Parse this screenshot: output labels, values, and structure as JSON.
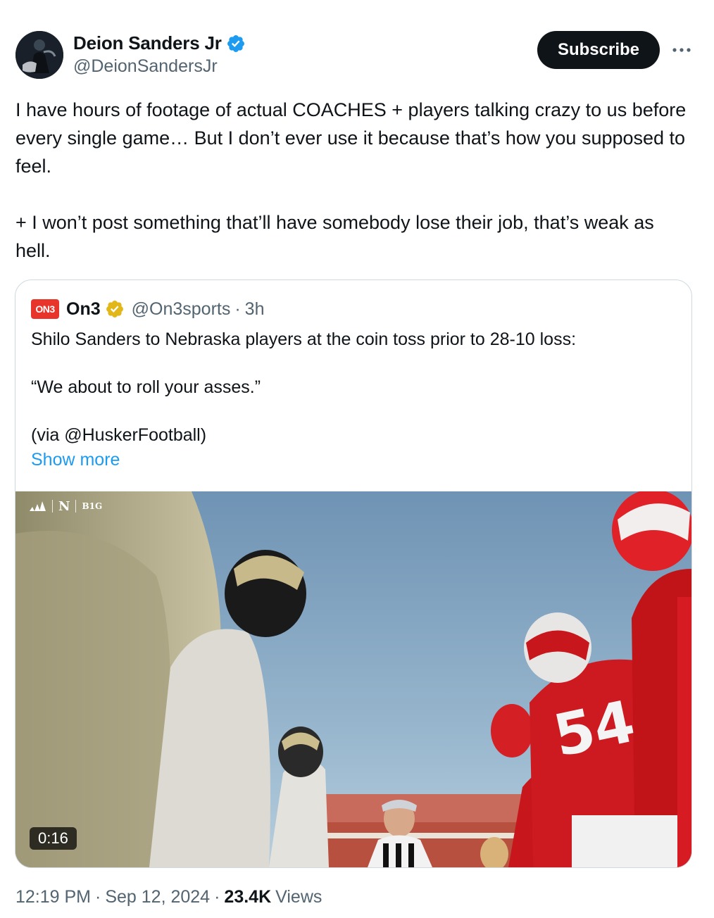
{
  "author": {
    "name": "Deion Sanders Jr",
    "handle": "@DeionSandersJr",
    "verified": true,
    "verified_color": "#1d9bf0",
    "avatar_icon": "profile-photo"
  },
  "actions": {
    "subscribe_label": "Subscribe",
    "more_icon": "ellipsis-icon"
  },
  "tweet": {
    "paragraphs": [
      "I have hours of footage of actual COACHES + players talking crazy to us before every single game… But I don’t ever use it because that’s how you supposed to feel.",
      "+ I won’t post something that’ll have somebody lose their job, that’s weak as hell."
    ]
  },
  "quote": {
    "logo_text": "ON3",
    "logo_color": "#e8352b",
    "name": "On3",
    "verified_color": "#e2b719",
    "handle": "@On3sports",
    "separator": "·",
    "time": "3h",
    "paragraphs": [
      "Shilo Sanders to Nebraska players at the coin toss prior to 28-10 loss:",
      "“We about to roll your asses.”",
      "(via @HuskerFootball)"
    ],
    "show_more": "Show more",
    "media": {
      "broadcast_marks": [
        "N",
        "B1G"
      ],
      "duration": "0:16"
    }
  },
  "meta": {
    "time": "12:19 PM",
    "sep1": "·",
    "date": "Sep 12, 2024",
    "sep2": "·",
    "views_count": "23.4K",
    "views_label": "Views"
  },
  "colors": {
    "text_primary": "#0f1419",
    "text_secondary": "#536471",
    "link": "#1d9bf0",
    "border": "#cfd9de"
  }
}
